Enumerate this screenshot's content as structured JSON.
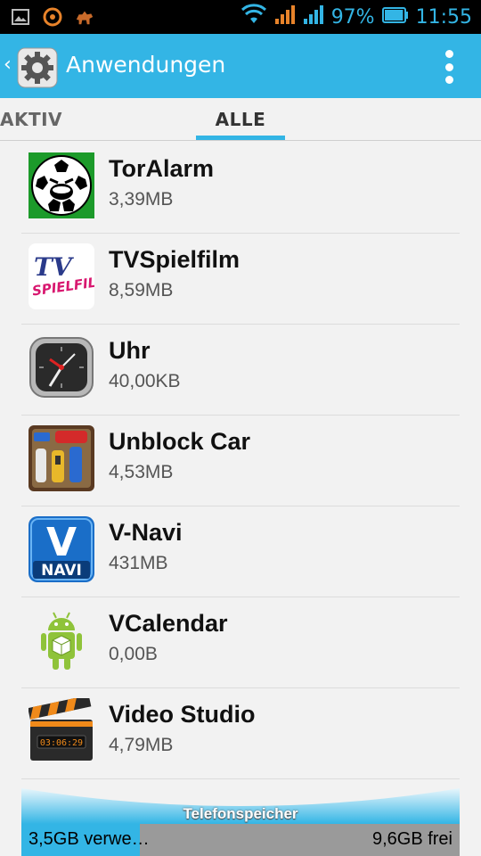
{
  "status_bar": {
    "left_icons": [
      "gallery-icon",
      "orange-app-icon",
      "animal-app-icon"
    ],
    "battery_percent": "97%",
    "battery_level": 0.97,
    "time": "11:55"
  },
  "action_bar": {
    "title": "Anwendungen",
    "icon": "gear-icon",
    "overflow_icon": "overflow-menu-icon"
  },
  "tabs": [
    {
      "label": "AKTIV",
      "selected": false
    },
    {
      "label": "ALLE",
      "selected": true
    }
  ],
  "apps": [
    {
      "name": "TorAlarm",
      "size": "3,39MB",
      "icon": "toralarm-icon"
    },
    {
      "name": "TVSpielfilm",
      "size": "8,59MB",
      "icon": "tvspielfilm-icon"
    },
    {
      "name": "Uhr",
      "size": "40,00KB",
      "icon": "clock-icon"
    },
    {
      "name": "Unblock Car",
      "size": "4,53MB",
      "icon": "unblock-car-icon"
    },
    {
      "name": "V-Navi",
      "size": "431MB",
      "icon": "v-navi-icon"
    },
    {
      "name": "VCalendar",
      "size": "0,00B",
      "icon": "android-icon"
    },
    {
      "name": "Video Studio",
      "size": "4,79MB",
      "icon": "clapperboard-icon"
    }
  ],
  "icon_text": {
    "tvspielfilm": [
      "TV",
      "SPIELFILM"
    ],
    "v_navi": [
      "V",
      "NAVI"
    ],
    "video_studio_timer": "03:06:29"
  },
  "storage": {
    "label": "Telefonspeicher",
    "used": "3,5GB verwe…",
    "free": "9,6GB frei",
    "used_fraction": 0.27
  },
  "colors": {
    "accent": "#33b5e5",
    "background": "#f2f2f2",
    "status_bar": "#000000",
    "storage_free_bg": "#9a9a9a"
  }
}
